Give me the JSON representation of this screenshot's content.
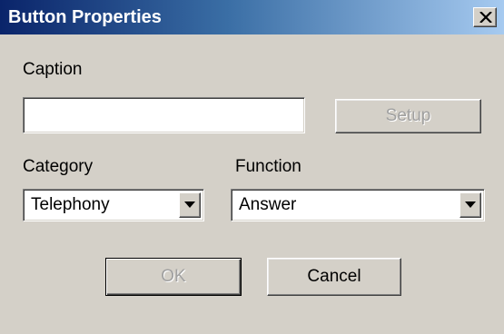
{
  "window": {
    "title": "Button Properties",
    "close_icon": "close-x-icon"
  },
  "caption": {
    "label": "Caption",
    "value": "",
    "setup_label": "Setup"
  },
  "category": {
    "label": "Category",
    "selected": "Telephony",
    "arrow_icon": "dropdown-arrow-icon"
  },
  "function": {
    "label": "Function",
    "selected": "Answer",
    "arrow_icon": "dropdown-arrow-icon"
  },
  "actions": {
    "ok_label": "OK",
    "cancel_label": "Cancel"
  },
  "colors": {
    "face": "#d4d0c8",
    "title_start": "#0a246a",
    "title_end": "#a6caf0",
    "disabled_text": "#a0a0a0"
  }
}
